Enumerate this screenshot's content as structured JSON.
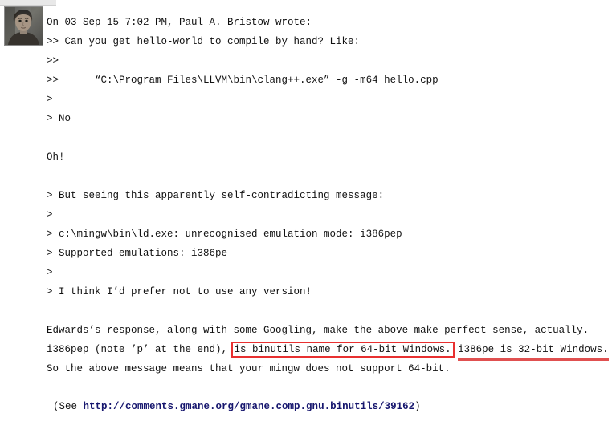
{
  "window": {
    "chrome_bar_color": "#e8e8e8"
  },
  "avatar": {
    "icon": "user-photo-avatar",
    "alt": "Sender profile photo"
  },
  "colors": {
    "highlight_box": "#e83030",
    "highlight_underline": "#e05050",
    "link": "#16166e",
    "text": "#111111"
  },
  "message": {
    "lines": [
      {
        "text": "On 03-Sep-15 7:02 PM, Paul A. Bristow wrote:",
        "name": "attribution-line"
      },
      {
        "text": ">> Can you get hello-world to compile by hand? Like:",
        "name": "quote-line"
      },
      {
        "text": ">>",
        "name": "quote-line"
      },
      {
        "text": ">>      “C:\\Program Files\\LLVM\\bin\\clang++.exe” -g -m64 hello.cpp",
        "name": "quote-line"
      },
      {
        "text": ">",
        "name": "quote-line"
      },
      {
        "text": "> No",
        "name": "quote-line"
      },
      {
        "text": "",
        "name": "blank-line"
      },
      {
        "text": "Oh!",
        "name": "reply-line"
      },
      {
        "text": "",
        "name": "blank-line"
      },
      {
        "text": "> But seeing this apparently self-contradicting message:",
        "name": "quote-line"
      },
      {
        "text": ">",
        "name": "quote-line"
      },
      {
        "text": "> c:\\mingw\\bin\\ld.exe: unrecognised emulation mode: i386pep",
        "name": "quote-line"
      },
      {
        "text": "> Supported emulations: i386pe",
        "name": "quote-line"
      },
      {
        "text": ">",
        "name": "quote-line"
      },
      {
        "text": "> I think I’d prefer not to use any version!",
        "name": "quote-line"
      },
      {
        "text": "",
        "name": "blank-line"
      },
      {
        "text": "Edwards’s response, along with some Googling, make the above make perfect sense, actually.",
        "name": "reply-line"
      }
    ],
    "annotated_line": {
      "name": "annotated-reply-line",
      "prefix": "i386pep (note ’p’ at the end), ",
      "boxed": "is binutils name for 64-bit Windows.",
      "middle": " ",
      "underlined": "i386pe is 32-bit Windows.",
      "suffix": ""
    },
    "closing_line": {
      "name": "closing-reply-line",
      "text": "So the above message means that your mingw does not support 64-bit."
    }
  },
  "footer": {
    "prefix": "(See ",
    "link_text": "http://comments.gmane.org/gmane.comp.gnu.binutils/39162",
    "suffix": ")"
  }
}
